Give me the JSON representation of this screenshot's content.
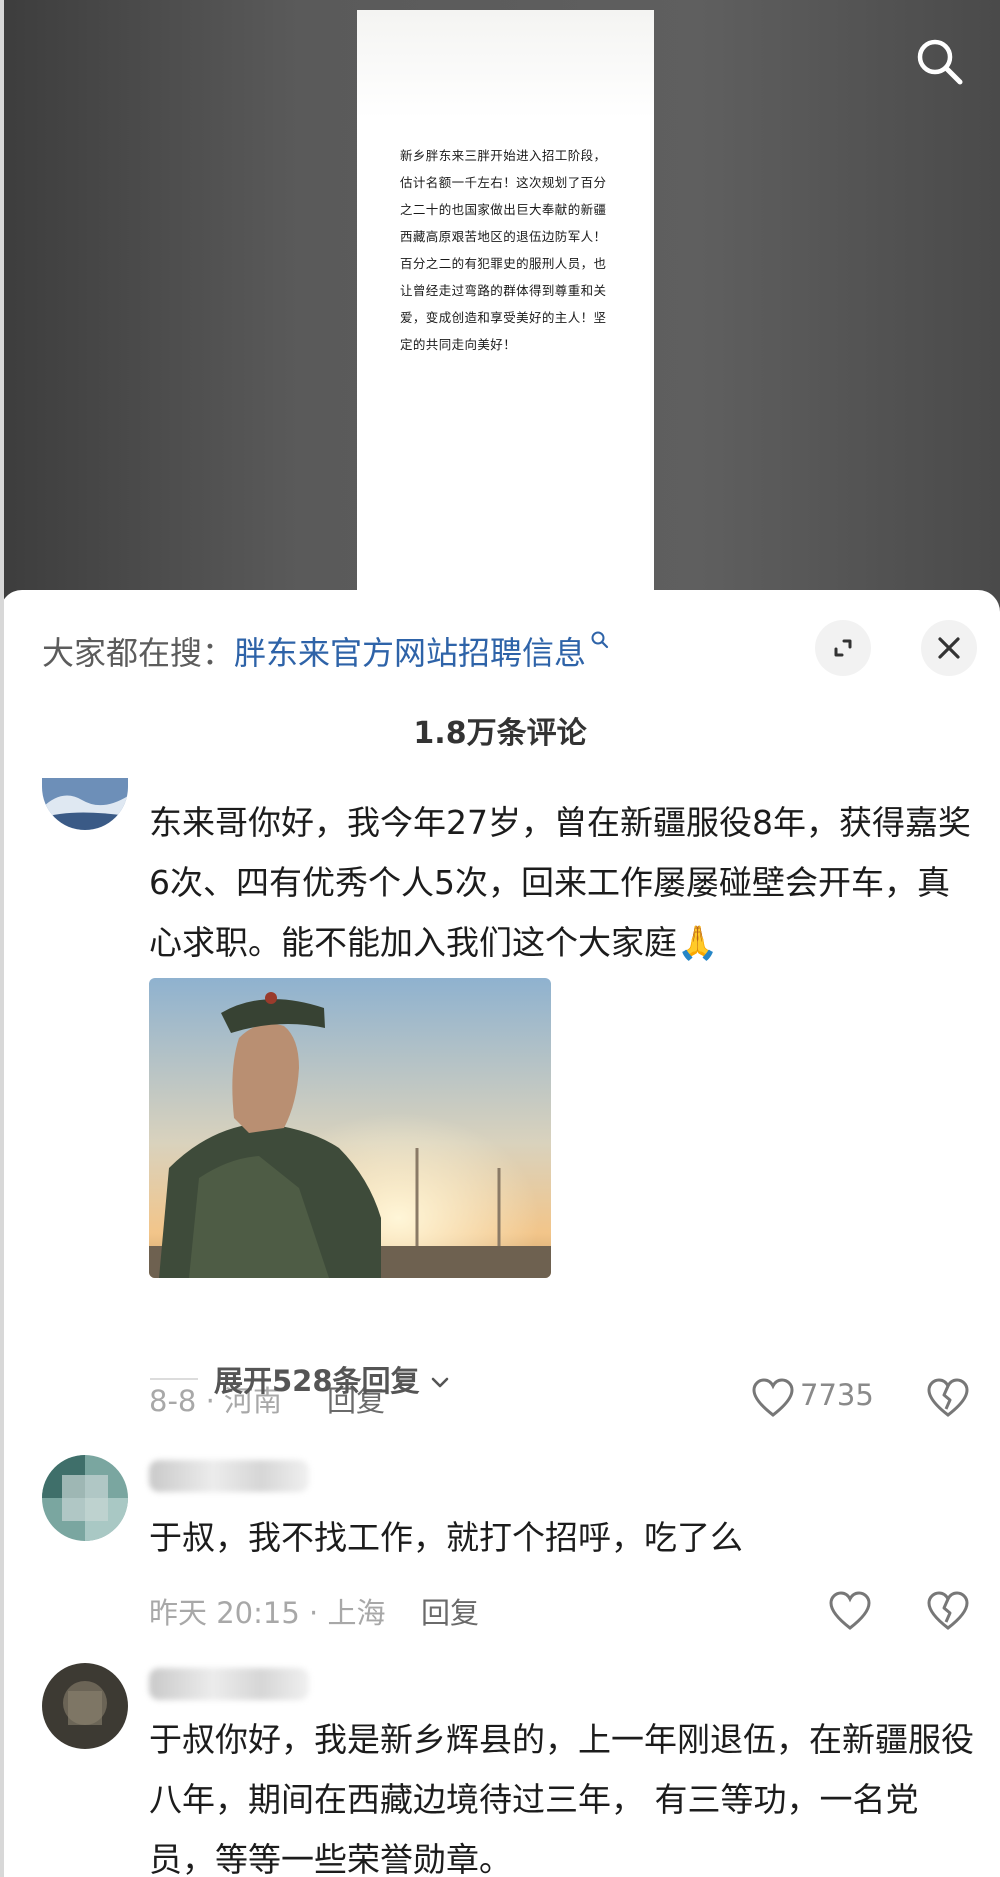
{
  "video": {
    "caption": "新乡胖东来三胖开始进入招工阶段，估计名额一千左右！这次规划了百分之二十的也国家做出巨大奉献的新疆西藏高原艰苦地区的退伍边防军人！百分之二的有犯罪史的服刑人员，也让曾经走过弯路的群体得到尊重和关爱，变成创造和享受美好的主人！坚定的共同走向美好！"
  },
  "icons": {
    "search": "search-icon",
    "expand": "expand-icon",
    "close": "close-icon",
    "like": "heart-icon",
    "dislike": "broken-heart-icon",
    "chevron": "chevron-down-icon"
  },
  "header": {
    "hot_search_prefix": "大家都在搜：",
    "hot_search_query": "胖东来官方网站招聘信息"
  },
  "comment_count": "1.8万条评论",
  "colors": {
    "link": "#2e63a8",
    "meta": "#a8a8a8",
    "text": "#1c1c1c"
  },
  "comments": [
    {
      "text": "东来哥你好，我今年27岁，曾在新疆服役8年，获得嘉奖6次、四有优秀个人5次，回来工作屡屡碰壁会开车，真心求职。能不能加入我们这个大家庭🙏",
      "date_location": "8-8 · 河南",
      "reply_label": "回复",
      "likes": "7735",
      "expand_replies": "展开528条回复"
    },
    {
      "text": "于叔，我不找工作，就打个招呼，吃了么",
      "date_location": "昨天 20:15 · 上海",
      "reply_label": "回复"
    },
    {
      "text": "于叔你好，我是新乡辉县的，上一年刚退伍，在新疆服役八年，期间在西藏边境待过三年， 有三等功，一名党员，等等一些荣誉勋章。"
    }
  ]
}
